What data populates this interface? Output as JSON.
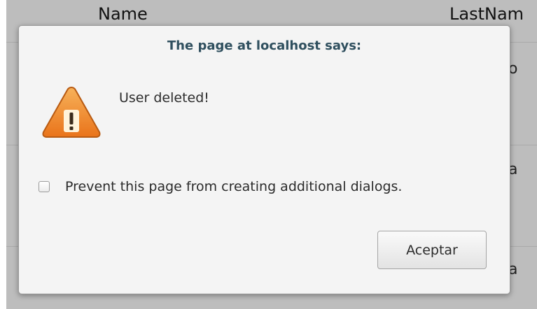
{
  "background_table": {
    "headers": [
      "Name",
      "LastNam"
    ],
    "visible_cells": [
      "o",
      "a",
      "a"
    ]
  },
  "dialog": {
    "title": "The page at localhost says:",
    "icon": "warning-icon",
    "message": "User deleted!",
    "prevent_checkbox": {
      "label": "Prevent this page from creating additional dialogs.",
      "checked": false
    },
    "ok_button_label": "Aceptar"
  },
  "colors": {
    "title": "#2f4f5e",
    "warning_fill": "#f08a24",
    "overlay": "#bdbdbd"
  }
}
